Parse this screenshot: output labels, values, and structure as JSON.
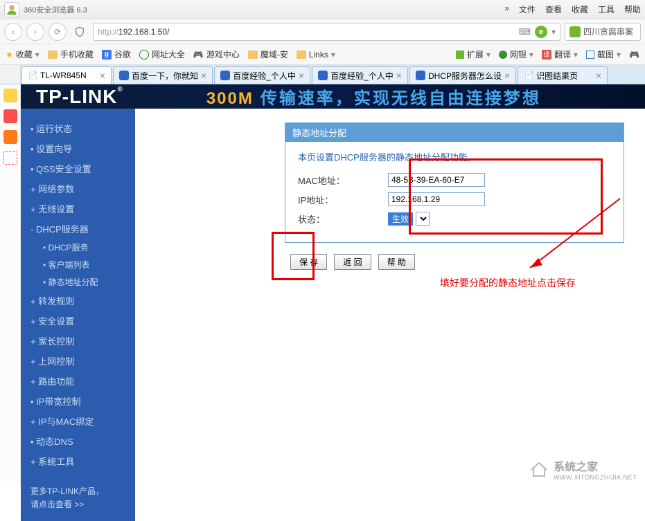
{
  "browser": {
    "title": "360安全浏览器 6.3",
    "menu": [
      "文件",
      "查看",
      "收藏",
      "工具",
      "帮助"
    ],
    "url_prefix": "http://",
    "url": "192.168.1.50/",
    "search_placeholder": "四川贪腐串案"
  },
  "bookmarks": {
    "fav_label": "收藏",
    "items": [
      "手机收藏",
      "谷歌",
      "网址大全",
      "游戏中心",
      "魔域-安",
      "Links"
    ],
    "right": [
      "扩展",
      "网银",
      "翻译",
      "截图"
    ]
  },
  "tabs": [
    {
      "label": "TL-WR845N",
      "active": true
    },
    {
      "label": "百度一下，你就知"
    },
    {
      "label": "百度经验_个人中"
    },
    {
      "label": "百度经验_个人中"
    },
    {
      "label": "DHCP服务器怎么设"
    },
    {
      "label": "识图结果页"
    }
  ],
  "banner": {
    "logo": "TP-LINK",
    "m300": "300M",
    "rest": "传输速率，实现无线自由连接梦想"
  },
  "nav": {
    "items": [
      "运行状态",
      "设置向导",
      "QSS安全设置",
      "网络参数",
      "无线设置"
    ],
    "dhcp_parent": "DHCP服务器",
    "dhcp_sub": [
      "DHCP服务",
      "客户端列表",
      "静态地址分配"
    ],
    "items2": [
      "转发规则",
      "安全设置",
      "家长控制",
      "上网控制",
      "路由功能",
      "IP带宽控制",
      "IP与MAC绑定",
      "动态DNS",
      "系统工具"
    ],
    "more_line1": "更多TP-LINK产品，",
    "more_line2": "请点击查看 >>"
  },
  "panel": {
    "title": "静态地址分配",
    "desc": "本页设置DHCP服务器的静态地址分配功能。",
    "mac_label": "MAC地址：",
    "mac_value": "48-5B-39-EA-60-E7",
    "ip_label": "IP地址：",
    "ip_value": "192.168.1.29",
    "status_label": "状态：",
    "status_value": "生效",
    "buttons": {
      "save": "保 存",
      "back": "返 回",
      "help": "帮 助"
    }
  },
  "annotation": {
    "text": "填好要分配的静态地址点击保存"
  },
  "watermark": {
    "text": "系统之家",
    "url": "WWW.XITONGZHIJIA.NET"
  }
}
